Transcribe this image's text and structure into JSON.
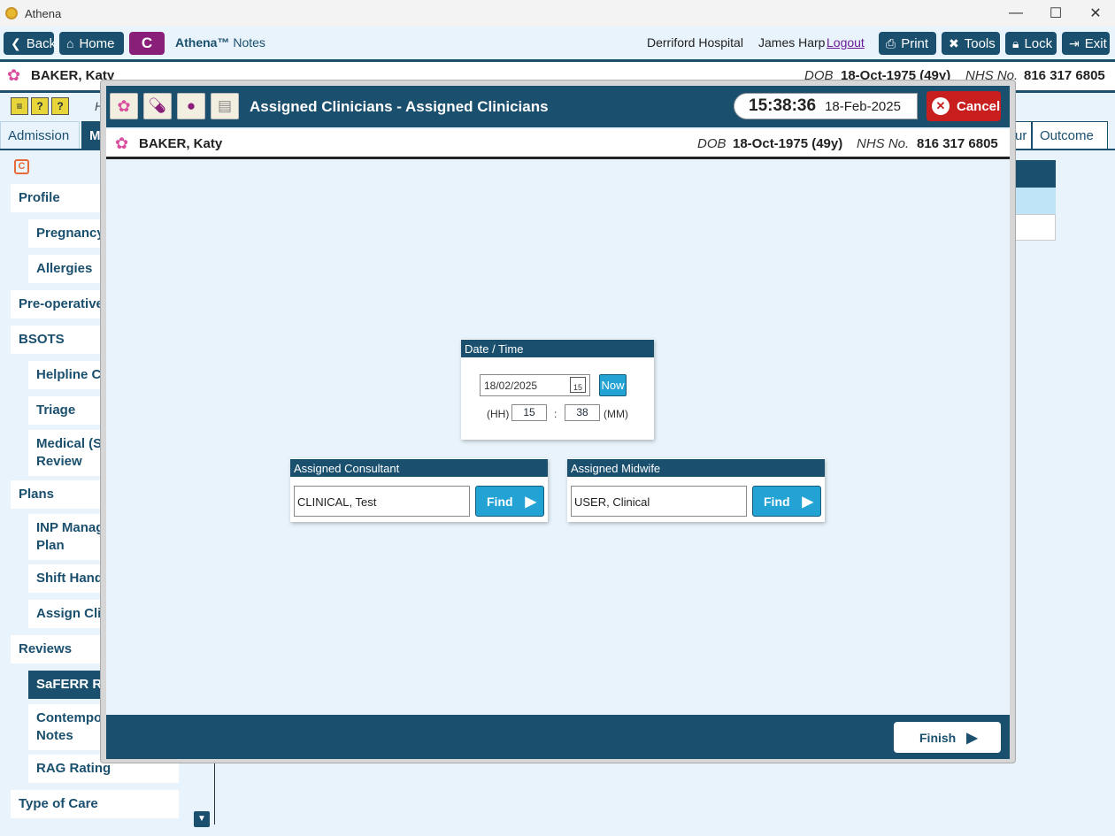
{
  "window": {
    "title": "Athena"
  },
  "toolbar": {
    "back_label": "Back",
    "home_label": "Home",
    "c_label": "C",
    "app_name": "Athena™",
    "app_section": "Notes",
    "hospital": "Derriford Hospital",
    "user": "James Harp",
    "logout_label": "Logout",
    "print_label": "Print",
    "tools_label": "Tools",
    "lock_label": "Lock",
    "exit_label": "Exit"
  },
  "patient": {
    "name": "BAKER, Katy",
    "dob_label": "DOB",
    "dob": "18-Oct-1975 (49y)",
    "nhs_label": "NHS No.",
    "nhs": "816 317 6805"
  },
  "background": {
    "h_text": "H",
    "tabs": [
      "Admission",
      "M",
      "ur",
      "Outcome"
    ],
    "sidebar": [
      {
        "label": "Profile",
        "level": 1
      },
      {
        "label": "Pregnancy",
        "level": 2
      },
      {
        "label": "Allergies",
        "level": 2
      },
      {
        "label": "Pre-operative",
        "level": 1
      },
      {
        "label": "BSOTS",
        "level": 1
      },
      {
        "label": "Helpline Co",
        "level": 2
      },
      {
        "label": "Triage",
        "level": 2
      },
      {
        "label": "Medical (Sa\nReview",
        "level": 2
      },
      {
        "label": "Plans",
        "level": 1
      },
      {
        "label": "INP Manag\nPlan",
        "level": 2
      },
      {
        "label": "Shift Hando",
        "level": 2
      },
      {
        "label": "Assign Clin",
        "level": 2
      },
      {
        "label": "Reviews",
        "level": 1
      },
      {
        "label": "SaFERR Rev",
        "level": 2,
        "active": true
      },
      {
        "label": "Contempor\nNotes",
        "level": 2
      },
      {
        "label": "RAG Rating",
        "level": 2
      },
      {
        "label": "Type of Care",
        "level": 1
      }
    ]
  },
  "modal": {
    "title": "Assigned Clinicians - Assigned Clinicians",
    "time": "15:38:36",
    "date": "18-Feb-2025",
    "cancel_label": "Cancel",
    "datetime": {
      "heading": "Date / Time",
      "date_value": "18/02/2025",
      "cal_day": "15",
      "now_label": "Now",
      "hh_label": "(HH)",
      "hh_value": "15",
      "colon": ":",
      "mm_value": "38",
      "mm_label": "(MM)"
    },
    "consultant": {
      "heading": "Assigned Consultant",
      "value": "CLINICAL, Test",
      "find_label": "Find"
    },
    "midwife": {
      "heading": "Assigned Midwife",
      "value": "USER, Clinical",
      "find_label": "Find"
    },
    "finish_label": "Finish"
  },
  "colors": {
    "primary": "#1a4f6e",
    "accent": "#23a2d4",
    "cancel": "#c81e1e",
    "c_button": "#8a1f7a",
    "background": "#e8f3fb"
  },
  "icons": [
    "back-icon",
    "home-icon",
    "print-icon",
    "tools-icon",
    "lock-icon",
    "exit-icon",
    "flower-icon",
    "calendar-icon",
    "play-icon",
    "cancel-x-icon"
  ]
}
